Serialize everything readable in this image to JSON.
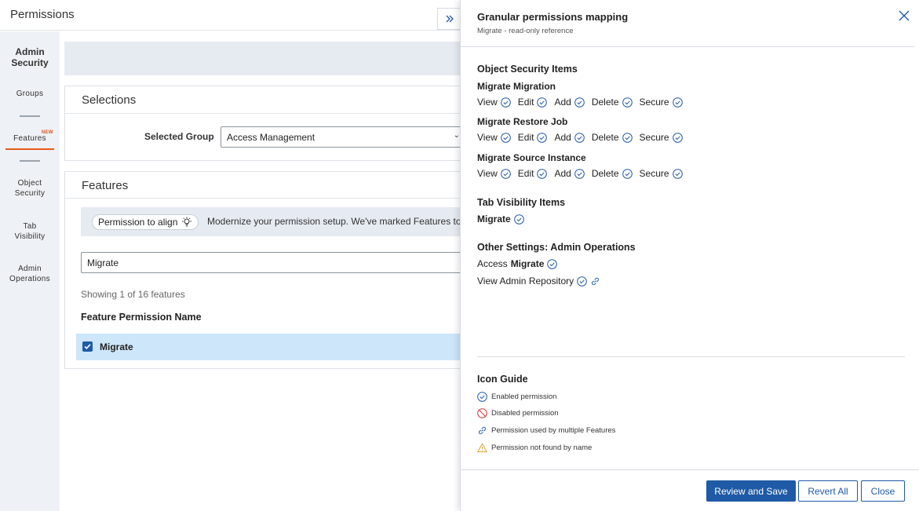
{
  "page": {
    "title": "Permissions"
  },
  "leftnav": {
    "heading_line1": "Admin",
    "heading_line2": "Security",
    "items": [
      {
        "line1": "Groups",
        "line2": ""
      },
      {
        "line1": "Features",
        "line2": "",
        "badge": "NEW",
        "active": true
      },
      {
        "line1": "Object",
        "line2": "Security"
      },
      {
        "line1": "Tab",
        "line2": "Visibility"
      },
      {
        "line1": "Admin",
        "line2": "Operations"
      }
    ]
  },
  "selections": {
    "title": "Selections",
    "group_label": "Selected Group",
    "group_value": "Access Management"
  },
  "features": {
    "title": "Features",
    "pill_label": "Permission to align",
    "info_text": "Modernize your permission setup. We've marked Features to he",
    "search_value": "Migrate",
    "showing": "Showing 1 of 16 features",
    "column_header": "Feature Permission Name",
    "rows": [
      {
        "label": "Migrate",
        "checked": true
      }
    ]
  },
  "panel": {
    "title": "Granular permissions mapping",
    "subtitle": "Migrate - read-only reference",
    "object_security": {
      "title": "Object Security Items",
      "items": [
        {
          "name": "Migrate Migration",
          "perms": [
            "View",
            "Edit",
            "Add",
            "Delete",
            "Secure"
          ]
        },
        {
          "name": "Migrate Restore Job",
          "perms": [
            "View",
            "Edit",
            "Add",
            "Delete",
            "Secure"
          ]
        },
        {
          "name": "Migrate Source Instance",
          "perms": [
            "View",
            "Edit",
            "Add",
            "Delete",
            "Secure"
          ]
        }
      ]
    },
    "tab_visibility": {
      "title": "Tab Visibility Items",
      "item": "Migrate"
    },
    "other_settings": {
      "title": "Other Settings: Admin Operations",
      "access_prefix": "Access",
      "access_name": "Migrate",
      "view_repo": "View Admin Repository"
    },
    "icon_guide": {
      "title": "Icon Guide",
      "enabled": "Enabled permission",
      "disabled": "Disabled permission",
      "multi": "Permission used by multiple Features",
      "notfound": "Permission not found by name"
    },
    "buttons": {
      "review": "Review and Save",
      "revert": "Revert All",
      "close": "Close"
    }
  },
  "colors": {
    "primary": "#1f5aa6",
    "accent_new": "#d9541a",
    "selected_row": "#cde6f9"
  }
}
